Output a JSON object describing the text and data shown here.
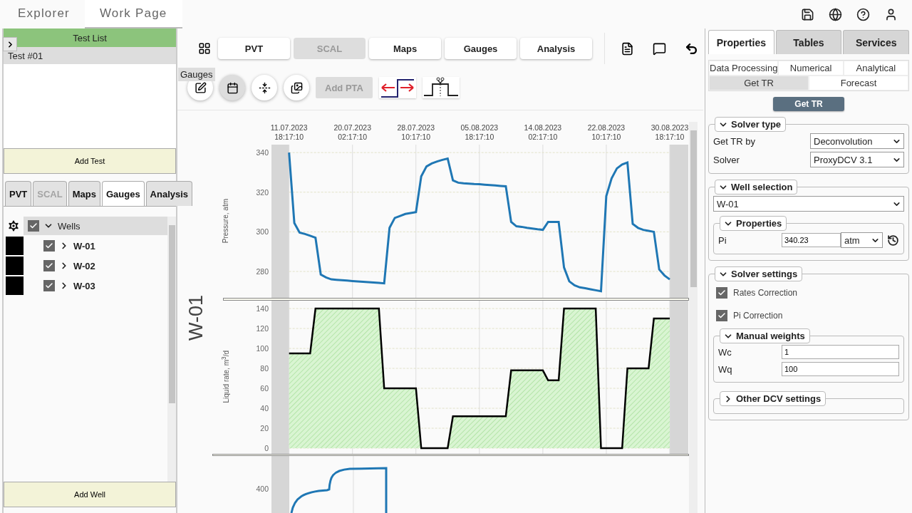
{
  "top_tabs": [
    {
      "label": "Explorer",
      "selected": false
    },
    {
      "label": "Work Page",
      "selected": true
    }
  ],
  "left_panel": {
    "header": "Test List",
    "tests": [
      {
        "label": "Test #01",
        "selected": true
      }
    ],
    "add_test": "Add Test",
    "tabs": [
      {
        "label": "PVT",
        "selected": false,
        "disabled": false
      },
      {
        "label": "SCAL",
        "selected": false,
        "disabled": true
      },
      {
        "label": "Maps",
        "selected": false,
        "disabled": false
      },
      {
        "label": "Gauges",
        "selected": true,
        "disabled": false
      },
      {
        "label": "Analysis",
        "selected": false,
        "disabled": false
      }
    ],
    "tree": {
      "label": "Wells",
      "checked": true,
      "expanded": true,
      "children": [
        {
          "label": "W-01",
          "checked": true,
          "expanded": false,
          "color": "#000000"
        },
        {
          "label": "W-02",
          "checked": true,
          "expanded": false,
          "color": "#000000"
        },
        {
          "label": "W-03",
          "checked": true,
          "expanded": false,
          "color": "#000000"
        }
      ]
    },
    "add_well": "Add Well"
  },
  "toolbar": {
    "tabs": [
      {
        "label": "PVT",
        "disabled": false
      },
      {
        "label": "SCAL",
        "disabled": true
      },
      {
        "label": "Maps",
        "disabled": false
      },
      {
        "label": "Gauges",
        "disabled": false
      },
      {
        "label": "Analysis",
        "disabled": false
      }
    ],
    "tooltip": "Gauges",
    "view_buttons": [
      {
        "selected": false
      },
      {
        "selected": true
      },
      {
        "selected": false
      },
      {
        "selected": false
      }
    ],
    "add_pta": {
      "label": "Add PTA",
      "disabled": true
    }
  },
  "plot": {
    "well": "W-01",
    "pressure": {
      "chart_data": {
        "type": "line",
        "ylabel": "Pressure, atm",
        "categories": [
          "11.07.2023 18:17:10",
          null,
          null,
          null,
          null,
          null,
          null,
          null,
          null,
          null,
          null,
          null,
          "20.07.2023 02:17:10",
          null,
          null,
          null,
          null,
          null,
          null,
          null,
          null,
          null,
          null,
          null,
          "28.07.2023 10:17:10",
          null,
          null,
          null,
          null,
          null,
          null,
          null,
          null,
          null,
          null,
          null,
          "05.08.2023 18:17:10",
          null,
          null,
          null,
          null,
          null,
          null,
          null,
          null,
          null,
          null,
          null,
          "14.08.2023 02:17:10",
          null,
          null,
          null,
          null,
          null,
          null,
          null,
          null,
          null,
          null,
          null,
          "22.08.2023 10:17:10",
          null,
          null,
          null,
          null,
          null,
          null,
          null,
          null,
          null,
          null,
          null,
          "30.08.2023 18:17:10"
        ],
        "series": [
          {
            "color": "#1f77b4",
            "values": [
              340,
              304.4,
              299.6,
              298.9,
              298,
              297,
              278.5,
              277,
              276,
              275.8,
              275.6,
              275.4,
              275.2,
              275,
              274.8,
              274.6,
              274.4,
              274.2,
              274,
              302,
              307,
              308,
              309,
              309.5,
              310,
              328,
              333,
              334.5,
              335.5,
              336.3,
              337,
              326,
              324.8,
              324.5,
              324.3,
              324.1,
              324,
              323.8,
              323.6,
              323.4,
              323.2,
              323,
              305,
              302.8,
              302.5,
              302,
              301.7,
              301.3,
              301,
              305,
              305,
              305,
              282,
              275,
              273,
              272,
              271.5,
              271,
              270.5,
              270,
              318,
              327,
              332,
              334,
              335,
              304,
              302,
              301,
              300.5,
              300,
              281,
              278,
              276
            ]
          }
        ],
        "grid": true,
        "ylim": [
          266.7,
          344
        ],
        "yticks": [
          {
            "value": 280,
            "label": "280"
          },
          {
            "value": 300,
            "label": "300"
          },
          {
            "value": 320,
            "label": "320"
          },
          {
            "value": 340,
            "label": "340"
          }
        ]
      }
    },
    "rate": {
      "chart_data": {
        "type": "area",
        "ylabel": "Liquid rate, m$^{3}$/d",
        "categories": [
          null,
          null,
          null,
          null,
          null,
          null,
          null,
          null,
          null,
          null,
          null,
          null,
          null,
          null,
          null,
          null,
          null,
          null,
          null,
          null,
          null,
          null,
          null,
          null,
          null,
          null,
          null,
          null,
          null,
          null,
          null,
          null,
          null,
          null,
          null,
          null,
          null,
          null,
          null,
          null,
          null,
          null,
          null,
          null,
          null,
          null,
          null,
          null,
          null,
          null,
          null,
          null,
          null,
          null,
          null,
          null,
          null,
          null,
          null,
          null,
          null,
          null,
          null,
          null,
          null,
          null,
          null,
          null,
          null,
          null,
          null,
          null,
          null
        ],
        "series": [
          {
            "color": "#000000",
            "values": [
              95,
              95,
              95,
              95,
              95,
              140,
              140,
              140,
              140,
              140,
              140,
              140,
              140,
              140,
              140,
              140,
              140,
              140,
              60,
              60,
              60,
              60,
              60,
              60,
              60,
              0,
              0,
              0,
              0,
              0,
              0,
              32,
              32,
              32,
              32,
              32,
              32,
              32,
              32,
              32,
              32,
              32,
              78,
              78,
              78,
              78,
              78,
              78,
              78,
              68,
              68,
              68,
              140,
              140,
              140,
              140,
              140,
              140,
              140,
              0,
              0,
              0,
              0,
              0,
              80,
              80,
              80,
              80,
              80,
              130,
              130,
              130,
              130
            ]
          }
        ],
        "grid": true,
        "ylim": [
          -5.7,
          147.9
        ],
        "yticks": [
          {
            "value": 0,
            "label": "0"
          },
          {
            "value": 20,
            "label": "20"
          },
          {
            "value": 40,
            "label": "40"
          },
          {
            "value": 60,
            "label": "60"
          },
          {
            "value": 80,
            "label": "80"
          },
          {
            "value": 100,
            "label": "100"
          },
          {
            "value": 120,
            "label": "120"
          },
          {
            "value": 140,
            "label": "140"
          }
        ]
      }
    },
    "lower_chart": {
      "ytick": "400"
    }
  },
  "right_panel": {
    "tabs": [
      {
        "label": "Properties",
        "selected": true
      },
      {
        "label": "Tables",
        "selected": false
      },
      {
        "label": "Services",
        "selected": false
      }
    ],
    "subtab_rows": [
      [
        {
          "label": "Data Processing",
          "selected": false
        },
        {
          "label": "Numerical",
          "selected": false
        },
        {
          "label": "Analytical",
          "selected": false
        }
      ],
      [
        {
          "label": "Get TR",
          "selected": true
        },
        {
          "label": "Forecast",
          "selected": false
        }
      ]
    ],
    "action_button": "Get TR",
    "solver_type": {
      "title": "Solver type",
      "expanded": true,
      "fields": [
        {
          "label": "Get TR by",
          "value": "Deconvolution"
        },
        {
          "label": "Solver",
          "value": "ProxyDCV 3.1"
        }
      ]
    },
    "well_selection": {
      "title": "Well selection",
      "expanded": true,
      "well": "W-01",
      "properties": {
        "title": "Properties",
        "expanded": true,
        "label": "Pi",
        "value": "340.23",
        "unit": "atm"
      }
    },
    "solver_settings": {
      "title": "Solver settings",
      "expanded": true,
      "options": [
        {
          "label": "Rates Correction",
          "checked": true
        },
        {
          "label": "Pi Correction",
          "checked": true
        }
      ],
      "manual_weights": {
        "title": "Manual weights",
        "expanded": true,
        "fields": [
          {
            "label": "Wc",
            "value": "1"
          },
          {
            "label": "Wq",
            "value": "100"
          }
        ]
      },
      "other": {
        "title": "Other DCV settings",
        "expanded": false
      }
    }
  }
}
